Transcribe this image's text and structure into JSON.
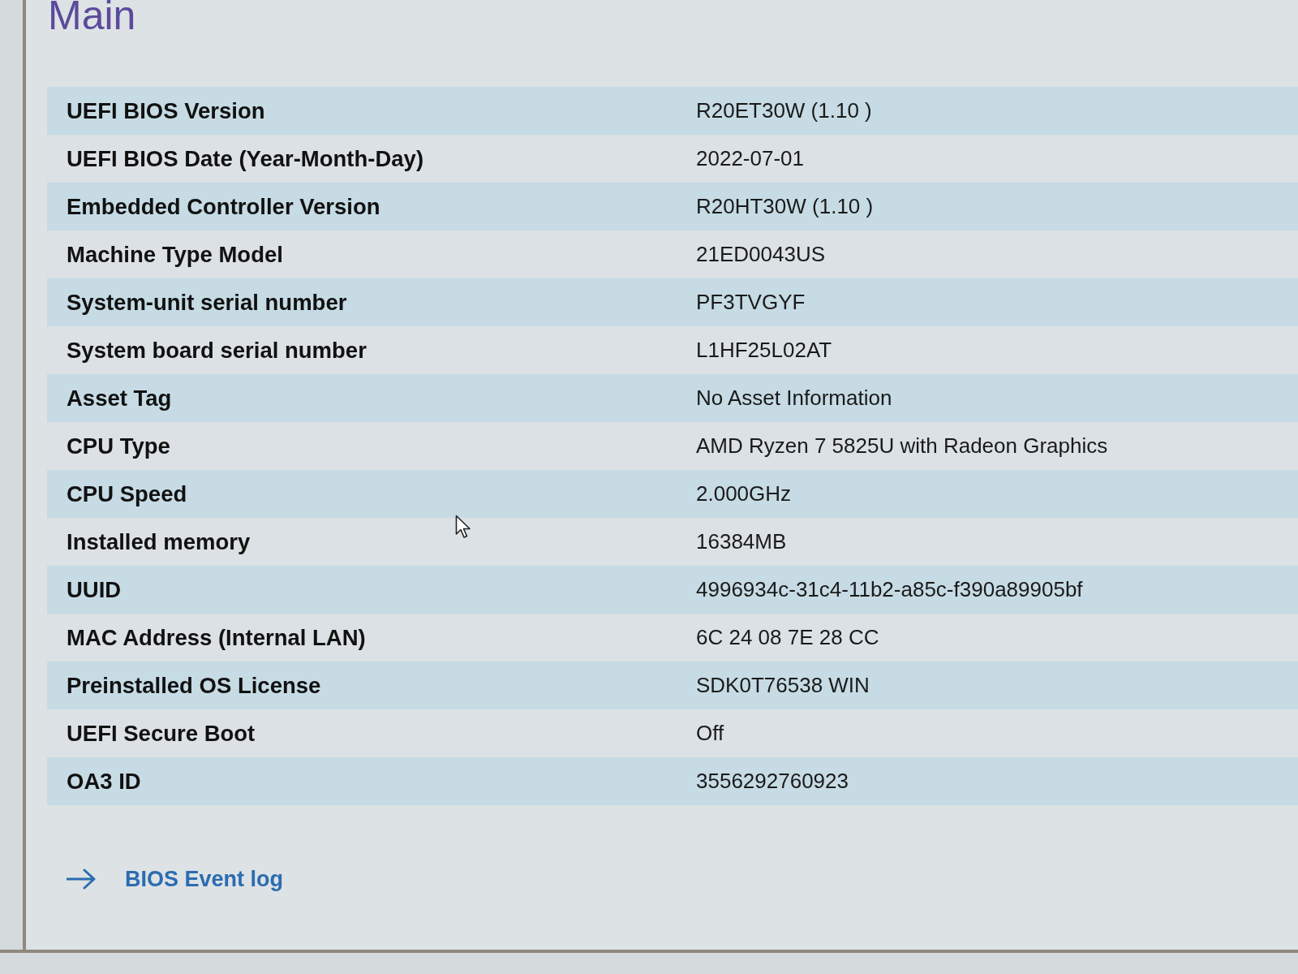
{
  "title": "Main",
  "rows": [
    {
      "label": "UEFI BIOS Version",
      "value": "R20ET30W (1.10 )"
    },
    {
      "label": "UEFI BIOS Date (Year-Month-Day)",
      "value": "2022-07-01"
    },
    {
      "label": "Embedded Controller Version",
      "value": "R20HT30W (1.10 )"
    },
    {
      "label": "Machine Type Model",
      "value": "21ED0043US"
    },
    {
      "label": "System-unit serial number",
      "value": "PF3TVGYF"
    },
    {
      "label": "System board serial number",
      "value": "L1HF25L02AT"
    },
    {
      "label": "Asset Tag",
      "value": "No Asset Information"
    },
    {
      "label": "CPU Type",
      "value": "AMD Ryzen 7 5825U with Radeon Graphics"
    },
    {
      "label": "CPU Speed",
      "value": "2.000GHz"
    },
    {
      "label": "Installed memory",
      "value": "16384MB"
    },
    {
      "label": "UUID",
      "value": "4996934c-31c4-11b2-a85c-f390a89905bf"
    },
    {
      "label": "MAC Address (Internal LAN)",
      "value": "6C 24 08 7E 28 CC"
    },
    {
      "label": "Preinstalled OS License",
      "value": "SDK0T76538 WIN"
    },
    {
      "label": "UEFI Secure Boot",
      "value": "Off"
    },
    {
      "label": "OA3 ID",
      "value": "3556292760923"
    }
  ],
  "link": {
    "label": "BIOS Event log"
  }
}
